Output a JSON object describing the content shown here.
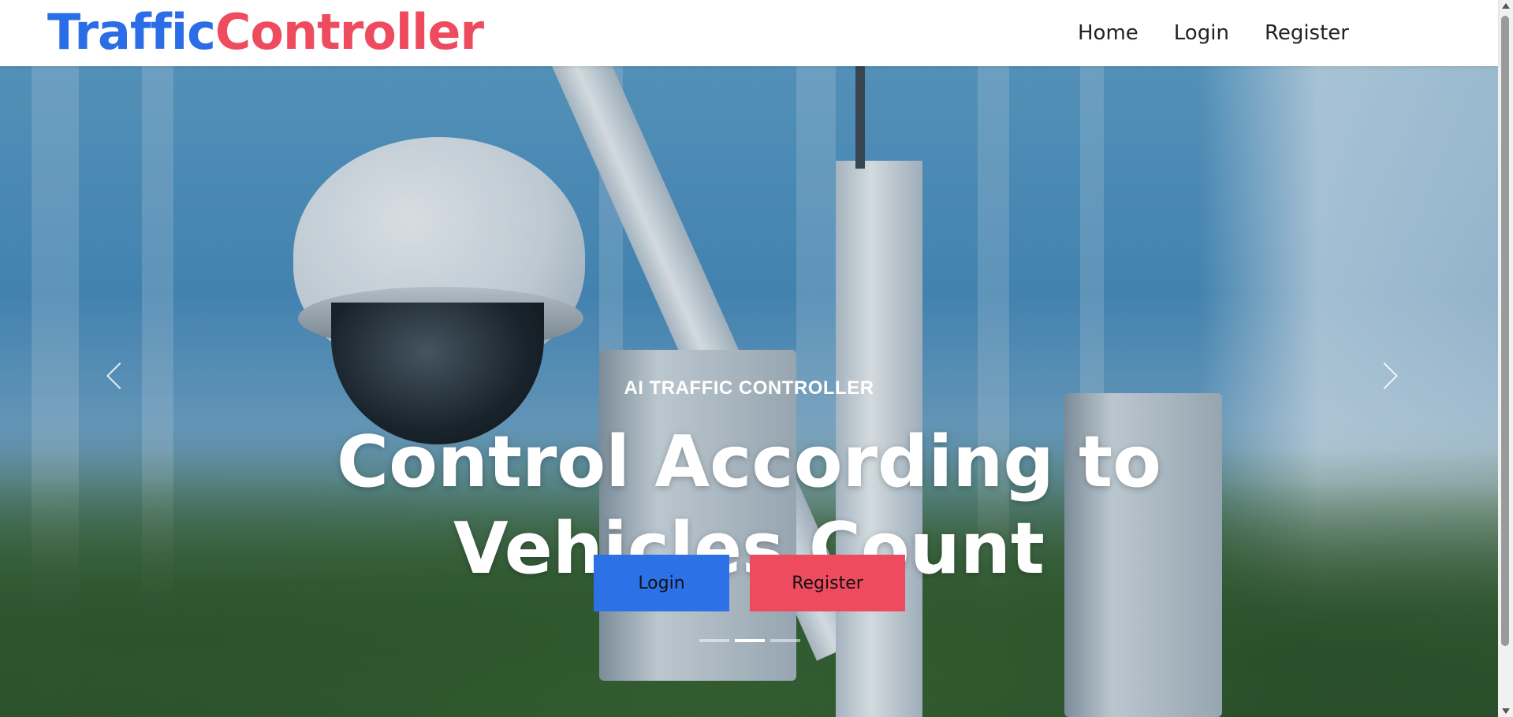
{
  "brand": {
    "part1": "Traffic",
    "part2": "Controller"
  },
  "nav": {
    "items": [
      {
        "label": "Home"
      },
      {
        "label": "Login"
      },
      {
        "label": "Register"
      }
    ]
  },
  "hero": {
    "eyebrow": "AI TRAFFIC CONTROLLER",
    "headline_line1": "Control According to",
    "headline_line2": "Vehicles Count",
    "login_button": "Login",
    "register_button": "Register",
    "slide_count": 3,
    "active_slide": 2
  },
  "colors": {
    "brand_blue": "#2b6de6",
    "brand_red": "#ee4c5e",
    "nav_text": "#222222"
  },
  "icons": {
    "prev": "chevron-left-icon",
    "next": "chevron-right-icon"
  }
}
